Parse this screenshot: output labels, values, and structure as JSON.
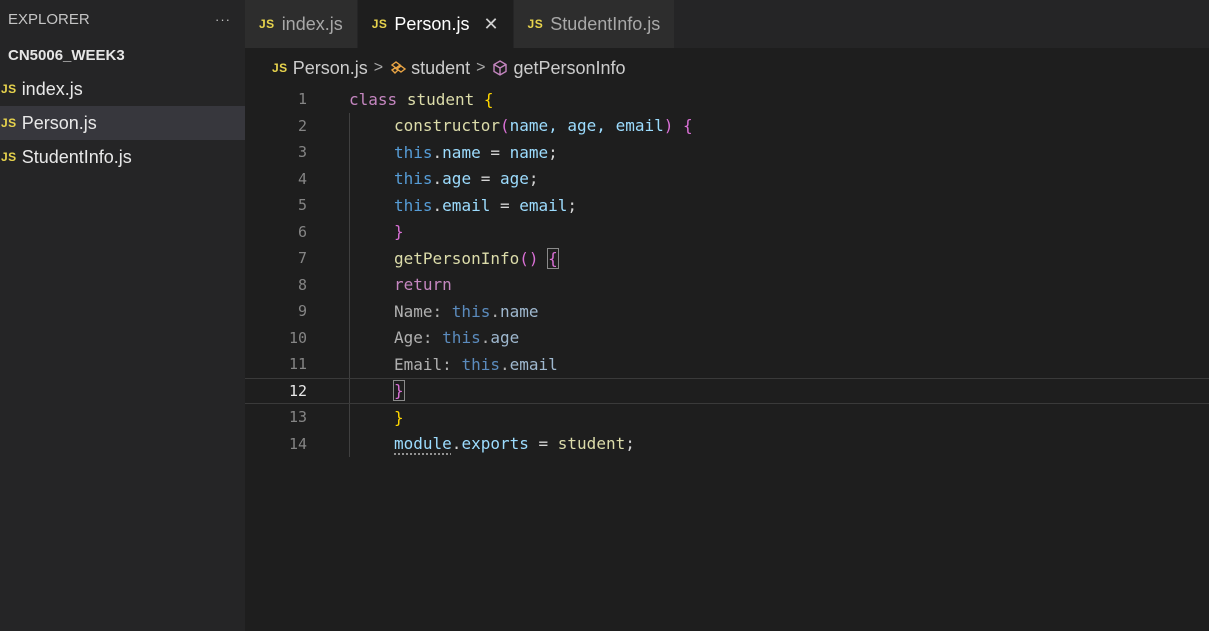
{
  "sidebar": {
    "title": "EXPLORER",
    "more": "···",
    "folder": "CN5006_WEEK3",
    "files": [
      {
        "badge": "JS",
        "name": "index.js"
      },
      {
        "badge": "JS",
        "name": "Person.js"
      },
      {
        "badge": "JS",
        "name": "StudentInfo.js"
      }
    ]
  },
  "tabs": [
    {
      "badge": "JS",
      "label": "index.js"
    },
    {
      "badge": "JS",
      "label": "Person.js",
      "close": "✕"
    },
    {
      "badge": "JS",
      "label": "StudentInfo.js"
    }
  ],
  "breadcrumb": {
    "badge": "JS",
    "file": "Person.js",
    "sep": ">",
    "class": "student",
    "method": "getPersonInfo"
  },
  "code": {
    "line_numbers": [
      "1",
      "2",
      "3",
      "4",
      "5",
      "6",
      "7",
      "8",
      "9",
      "10",
      "11",
      "12",
      "13",
      "14"
    ],
    "current_line": 12,
    "l1": {
      "kw": "class",
      "name": "student",
      "brace": "{"
    },
    "l2": {
      "fn": "constructor",
      "open": "(",
      "params": "name, age, email",
      "close": ")",
      "brace": "{"
    },
    "l3": {
      "this": "this",
      "dot": ".",
      "prop": "name",
      "eq": " = ",
      "val": "name",
      "semi": ";"
    },
    "l4": {
      "this": "this",
      "dot": ".",
      "prop": "age",
      "eq": " = ",
      "val": "age",
      "semi": ";"
    },
    "l5": {
      "this": "this",
      "dot": ".",
      "prop": "email",
      "eq": " = ",
      "val": "email",
      "semi": ";"
    },
    "l6": {
      "brace": "}"
    },
    "l7": {
      "fn": "getPersonInfo",
      "parens": "()",
      "brace": "{"
    },
    "l8": {
      "kw": "return"
    },
    "l9": {
      "label": "Name: ",
      "this": "this",
      "dot": ".",
      "prop": "name"
    },
    "l10": {
      "label": "Age: ",
      "this": "this",
      "dot": ".",
      "prop": "age"
    },
    "l11": {
      "label": "Email: ",
      "this": "this",
      "dot": ".",
      "prop": "email"
    },
    "l12": {
      "brace": "}"
    },
    "l13": {
      "brace": "}"
    },
    "l14": {
      "obj": "module",
      "dot": ".",
      "prop": "exports",
      "eq": " = ",
      "val": "student",
      "semi": ";"
    }
  },
  "colors": {
    "badge": "#e8d44d",
    "editor_bg": "#1e1e1e",
    "sidebar_bg": "#252526"
  }
}
